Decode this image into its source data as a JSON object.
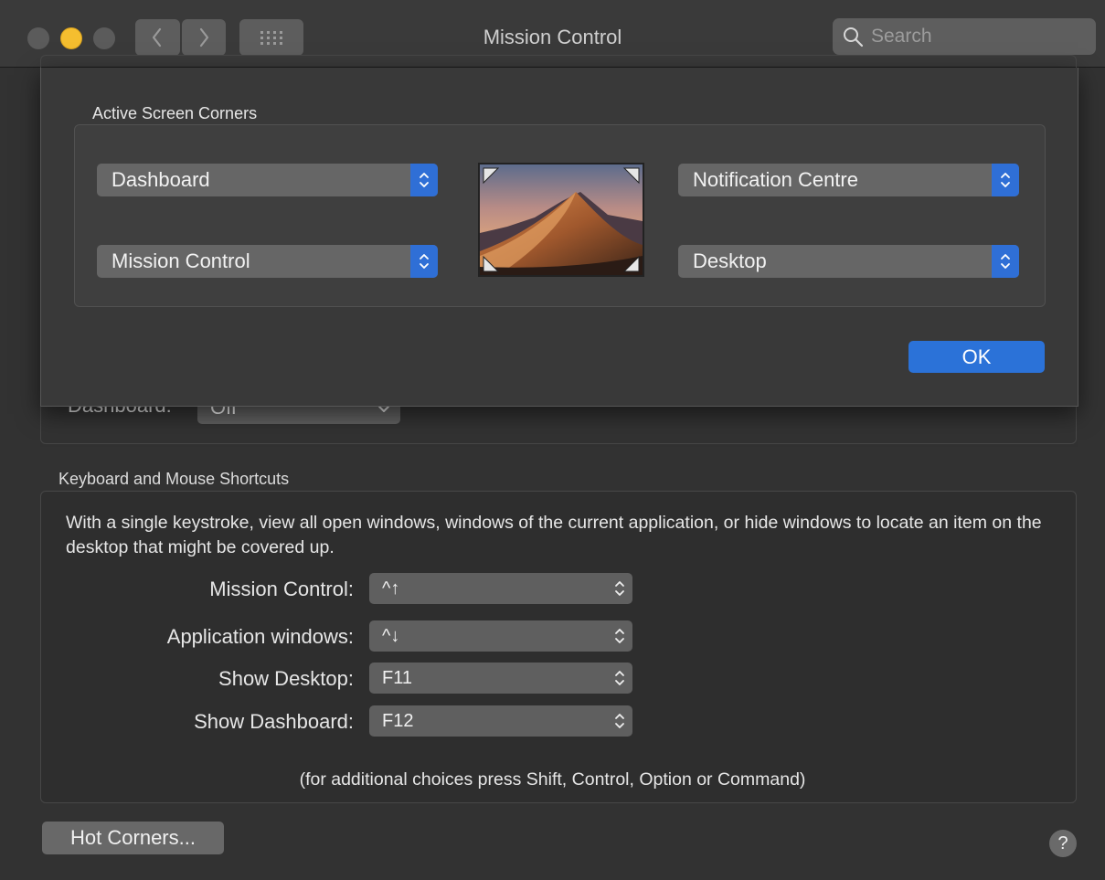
{
  "window": {
    "title": "Mission Control"
  },
  "search": {
    "placeholder": "Search"
  },
  "background": {
    "dashboard_label": "Dashboard:",
    "dashboard_value": "Off"
  },
  "keyboard": {
    "section_title": "Keyboard and Mouse Shortcuts",
    "description": "With a single keystroke, view all open windows, windows of the current application, or hide windows to locate an item on the desktop that might be covered up.",
    "shortcuts": [
      {
        "label": "Mission Control:",
        "value": "^↑"
      },
      {
        "label": "Application windows:",
        "value": "^↓"
      },
      {
        "label": "Show Desktop:",
        "value": "F11"
      },
      {
        "label": "Show Dashboard:",
        "value": "F12"
      }
    ],
    "hint": "(for additional choices press Shift, Control, Option or Command)"
  },
  "buttons": {
    "hot_corners": "Hot Corners...",
    "help": "?"
  },
  "sheet": {
    "title": "Active Screen Corners",
    "top_left": "Dashboard",
    "top_right": "Notification Centre",
    "bottom_left": "Mission Control",
    "bottom_right": "Desktop",
    "ok": "OK"
  },
  "colors": {
    "accent": "#2b72d8",
    "minimize": "#f5be2f"
  }
}
